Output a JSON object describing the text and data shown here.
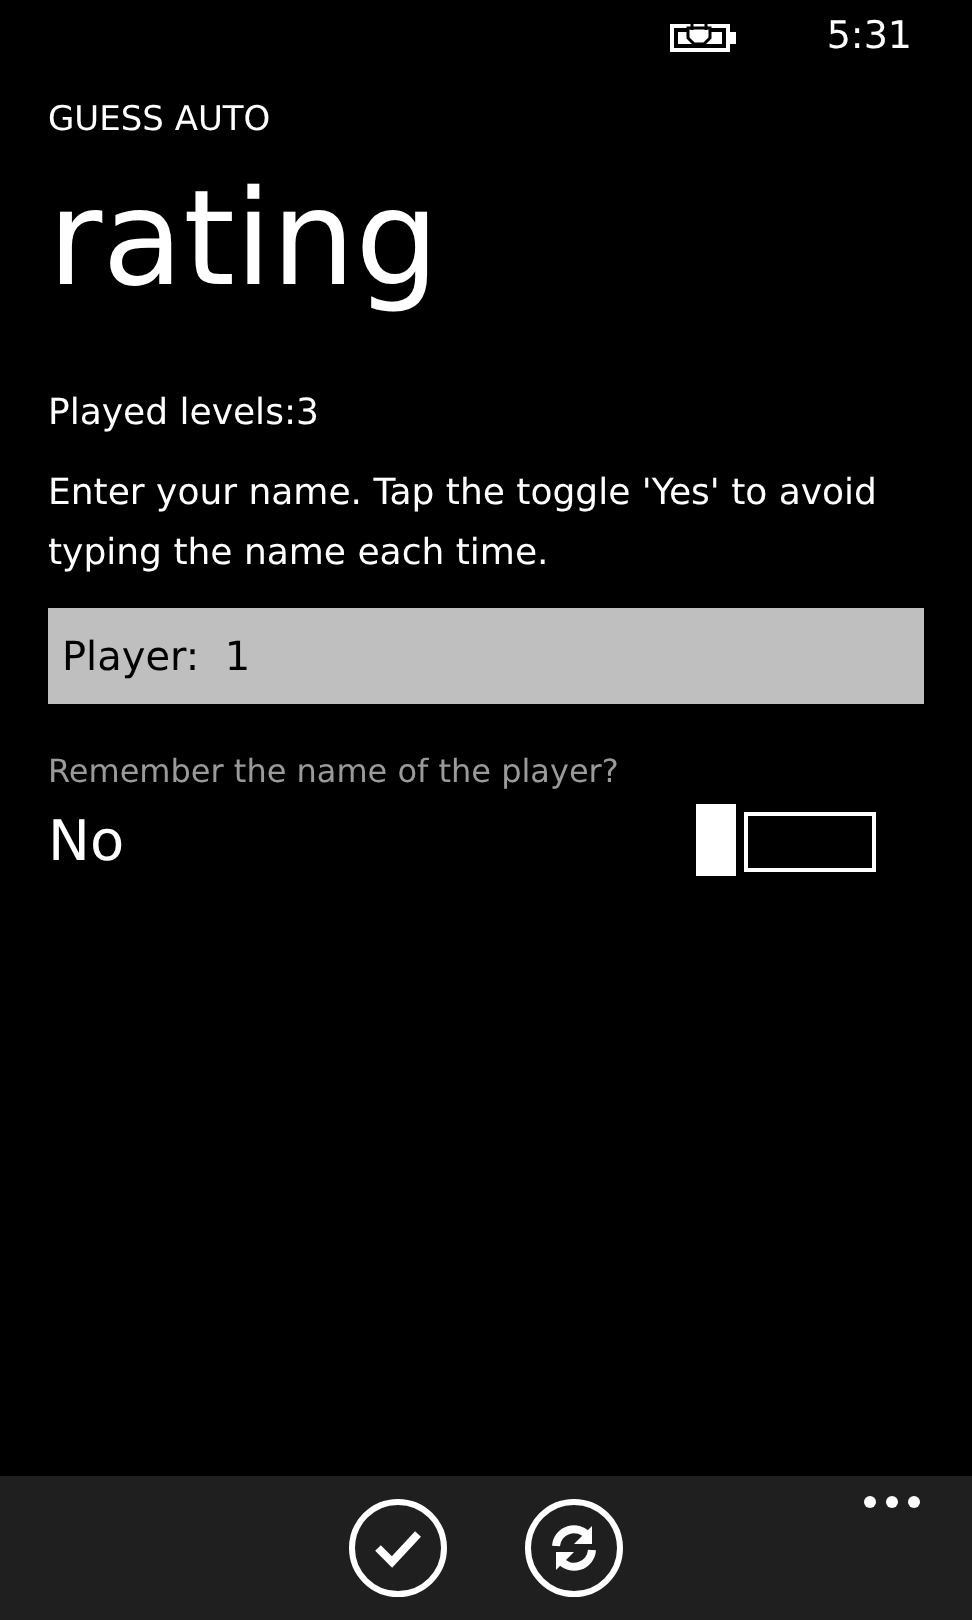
{
  "status_bar": {
    "time": "5:31"
  },
  "app_title": "GUESS AUTO",
  "page_title": "rating",
  "played_levels": "Played levels:3",
  "instructions": "Enter your name. Tap the toggle 'Yes' to avoid typing the name each time.",
  "name_field": {
    "value": "Player:  1"
  },
  "remember_toggle": {
    "label": "Remember the name of the player?",
    "state_text": "No",
    "on": false
  },
  "app_bar": {
    "buttons": [
      {
        "kind": "check"
      },
      {
        "kind": "refresh"
      }
    ]
  }
}
